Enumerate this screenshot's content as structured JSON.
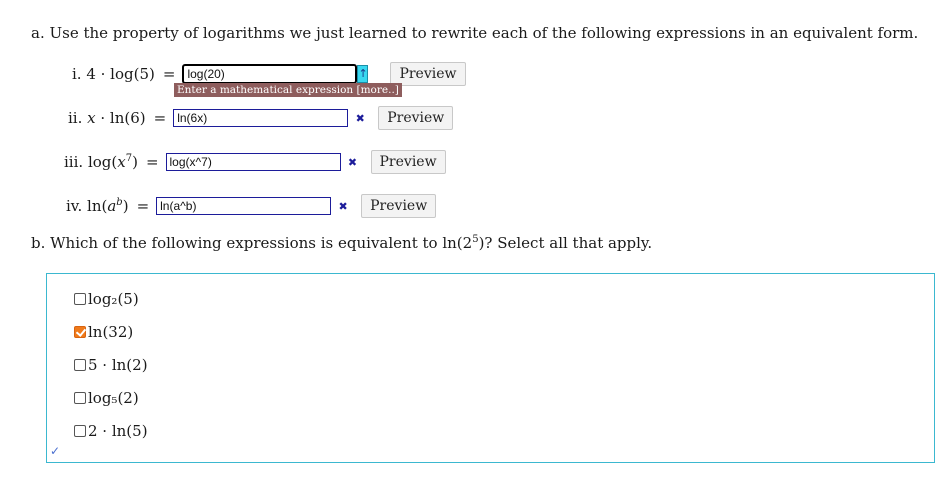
{
  "part_a": {
    "prompt": "a. Use the property of logarithms we just learned to rewrite each of the following expressions in an equivalent form.",
    "rows": [
      {
        "label": "i. 4 · log(5)",
        "equals": "=",
        "value": "log(20)",
        "preview_label": "Preview",
        "status": "active"
      },
      {
        "label": "ii.",
        "equals": "=",
        "value": "ln(6x)",
        "preview_label": "Preview",
        "status": "incorrect"
      },
      {
        "label": "iii.",
        "equals": "=",
        "value": "log(x^7)",
        "preview_label": "Preview",
        "status": "incorrect"
      },
      {
        "label": "iv.",
        "equals": "=",
        "value": "ln(a^b)",
        "preview_label": "Preview",
        "status": "incorrect"
      }
    ],
    "tooltip": "Enter a mathematical expression [more..]",
    "arrow_glyph": "↑",
    "incorrect_glyph": "✖"
  },
  "part_b": {
    "prompt_prefix": "b. Which of the following expressions is equivalent to",
    "prompt_suffix": "? Select all that apply.",
    "options": [
      {
        "text": "log₂(5)",
        "checked": false
      },
      {
        "text": "ln(32)",
        "checked": true
      },
      {
        "text": "5 · ln(2)",
        "checked": false
      },
      {
        "text": "log₅(2)",
        "checked": false
      },
      {
        "text": "2 · ln(5)",
        "checked": false
      }
    ],
    "checkmark_glyph": "✓"
  },
  "colors": {
    "accent_cyan": "#38d8f0",
    "box_border": "#3bb8d0",
    "checked_orange": "#f07a1a",
    "tooltip_bg": "#8e5d5d",
    "incorrect_blue": "#1c1c9a"
  }
}
